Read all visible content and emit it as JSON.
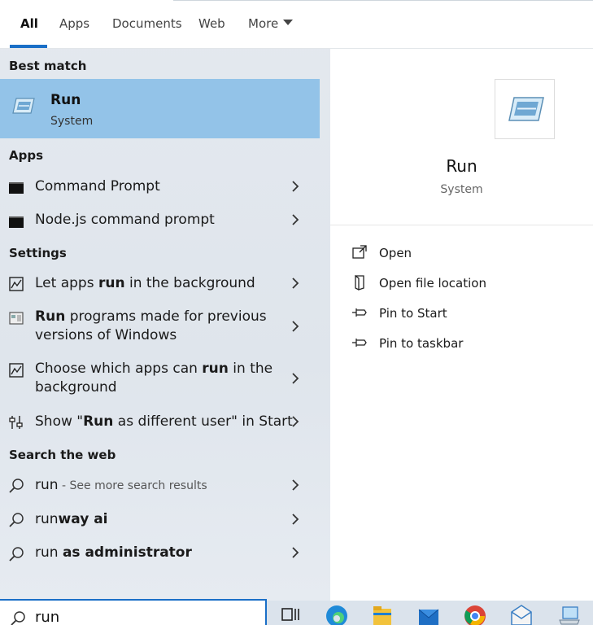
{
  "tabs": [
    {
      "label": "All"
    },
    {
      "label": "Apps"
    },
    {
      "label": "Documents"
    },
    {
      "label": "Web"
    },
    {
      "label": "More"
    }
  ],
  "best_match": {
    "heading": "Best match",
    "title": "Run",
    "subtitle": "System"
  },
  "apps": {
    "heading": "Apps",
    "items": [
      {
        "label": "Command Prompt"
      },
      {
        "label": "Node.js command prompt"
      }
    ]
  },
  "settings": {
    "heading": "Settings",
    "items": [
      {
        "pre": "Let apps ",
        "bold": "run",
        "post": " in the background"
      },
      {
        "pre": "",
        "bold": "Run",
        "post": " programs made for previous",
        "line2": "versions of Windows"
      },
      {
        "pre": "Choose which apps can ",
        "bold": "run",
        "post": " in the",
        "line2": "background"
      },
      {
        "pre": "Show \"",
        "bold": "Run",
        "post": " as different user\" in Start"
      }
    ]
  },
  "web": {
    "heading": "Search the web",
    "items": [
      {
        "pre": "run",
        "bold": "",
        "muted": " - See more search results"
      },
      {
        "pre": "run",
        "bold": "way ai",
        "muted": ""
      },
      {
        "pre": "run ",
        "bold": "as administrator",
        "muted": ""
      }
    ]
  },
  "preview": {
    "title": "Run",
    "subtitle": "System",
    "actions": [
      {
        "label": "Open",
        "icon": "open-icon"
      },
      {
        "label": "Open file location",
        "icon": "file-location-icon"
      },
      {
        "label": "Pin to Start",
        "icon": "pin-icon"
      },
      {
        "label": "Pin to taskbar",
        "icon": "pin-icon"
      }
    ]
  },
  "search": {
    "value": "run"
  },
  "taskbar_icons": [
    "task-view-icon",
    "edge-icon",
    "file-explorer-icon",
    "mail-icon",
    "chrome-icon",
    "app-icon",
    "laptop-icon"
  ]
}
